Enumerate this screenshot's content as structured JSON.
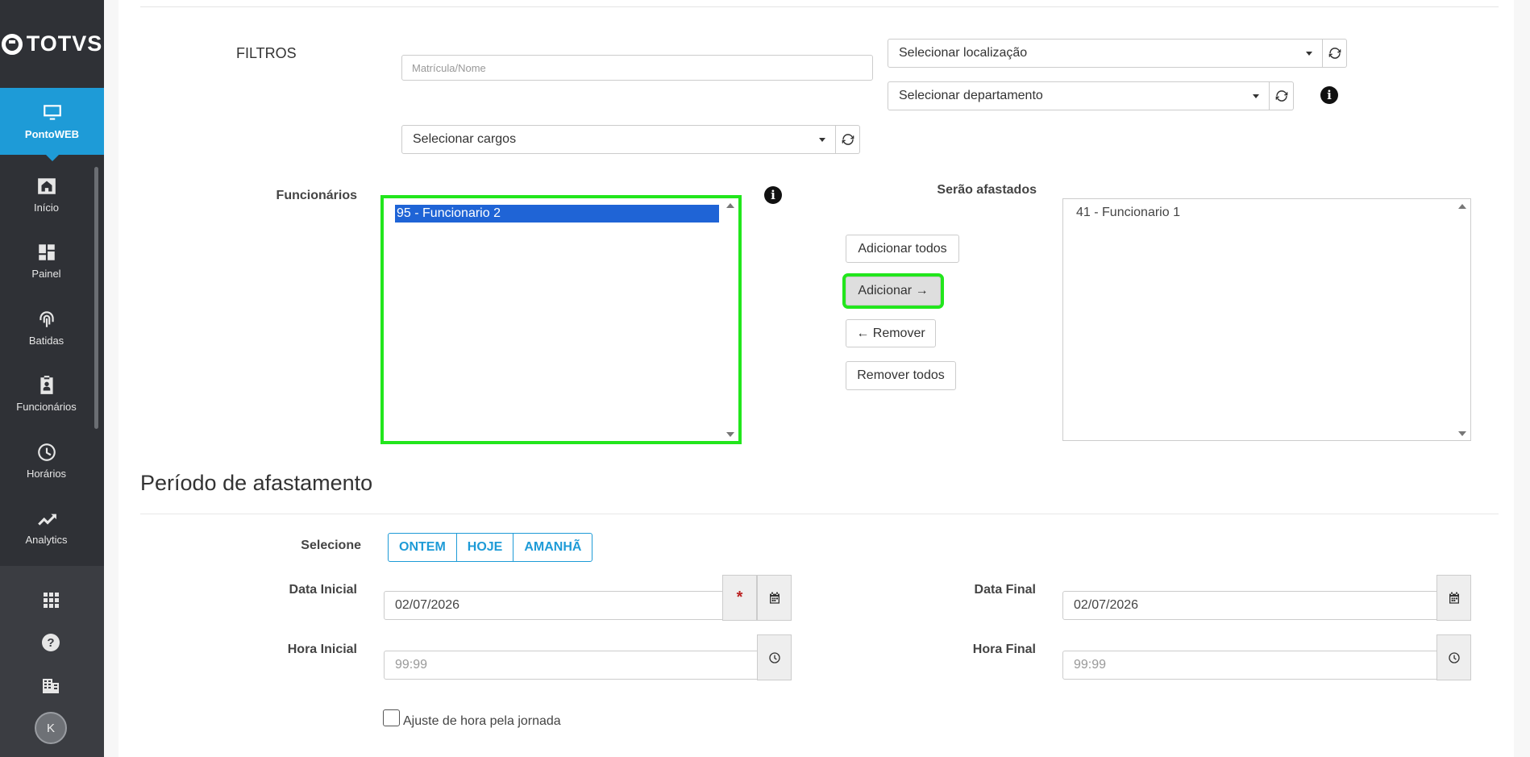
{
  "sidebar": {
    "logo": "TOTVS",
    "active": "PontoWEB",
    "items": [
      {
        "label": "Início",
        "icon": "home-icon"
      },
      {
        "label": "Painel",
        "icon": "dashboard-icon"
      },
      {
        "label": "Batidas",
        "icon": "fingerprint-icon"
      },
      {
        "label": "Funcionários",
        "icon": "badge-icon"
      },
      {
        "label": "Horários",
        "icon": "clock-icon"
      },
      {
        "label": "Analytics",
        "icon": "trend-icon"
      }
    ],
    "bottom_icons": [
      "apps-grid-icon",
      "help-icon",
      "building-icon"
    ],
    "avatar_initial": "K"
  },
  "filters": {
    "title": "FILTROS",
    "search_placeholder": "Matrícula/Nome",
    "location": "Selecionar localização",
    "department": "Selecionar departamento",
    "positions": "Selecionar cargos"
  },
  "employees": {
    "label": "Funcionários",
    "items": [
      "95 - Funcionario 2"
    ],
    "selected": "95 - Funcionario 2"
  },
  "removed": {
    "label": "Serão afastados",
    "items": [
      "41 - Funcionario 1"
    ]
  },
  "actions": {
    "add_all": "Adicionar todos",
    "add": "Adicionar →",
    "remove": "← Remover",
    "remove_all": "Remover todos"
  },
  "period": {
    "title": "Período de afastamento",
    "select_label": "Selecione",
    "quick": [
      "ONTEM",
      "HOJE",
      "AMANHÃ"
    ],
    "start_date_label": "Data Inicial",
    "start_date": "02/07/2026",
    "end_date_label": "Data Final",
    "end_date": "02/07/2026",
    "start_time_label": "Hora Inicial",
    "start_time_placeholder": "99:99",
    "end_time_label": "Hora Final",
    "end_time_placeholder": "99:99",
    "adjust_label": "Ajuste de hora pela jornada",
    "required_mark": "*"
  },
  "colors": {
    "sidebar": "#2f3136",
    "accent": "#1e9bd7",
    "highlight": "#22e61c",
    "selection": "#1f64d6"
  }
}
